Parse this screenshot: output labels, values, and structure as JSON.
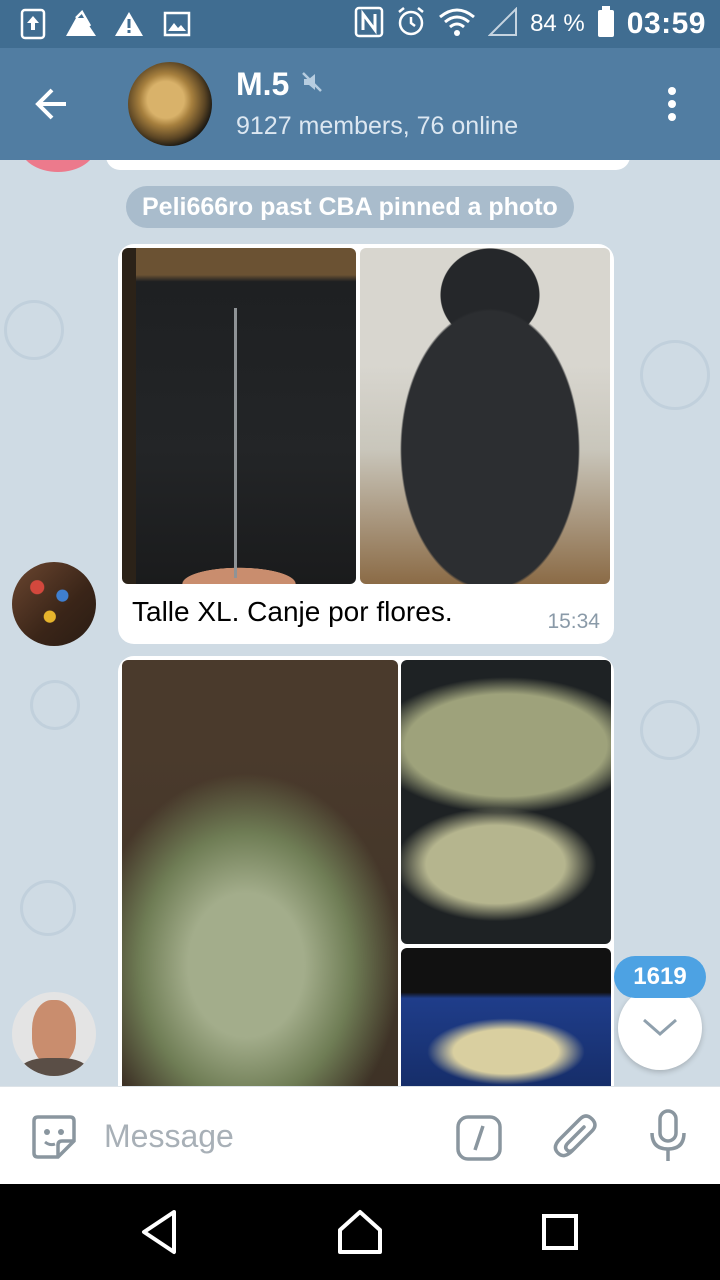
{
  "status_bar": {
    "battery_percent": "84 %",
    "time": "03:59",
    "icons": [
      "upload-icon",
      "drive-icon",
      "warning-icon",
      "image-icon",
      "nfc-icon",
      "alarm-icon",
      "wifi-icon",
      "signal-icon",
      "battery-icon"
    ]
  },
  "header": {
    "title": "M.5",
    "subtitle": "9127 members, 76 online",
    "muted": true
  },
  "chat": {
    "service_message": "Peli666ro past CBA pinned a photo",
    "messages": [
      {
        "type": "photo-album",
        "photos": [
          "jacket-front-photo",
          "jacket-back-photo"
        ],
        "caption": "Talle XL. Canje por flores.",
        "time": "15:34"
      },
      {
        "type": "photo-album",
        "photos": [
          "bud-closeup-photo",
          "bud-top-photo",
          "bud-on-tray-photo"
        ]
      }
    ],
    "unread_count": "1619"
  },
  "input": {
    "placeholder": "Message"
  },
  "colors": {
    "header": "#517da2",
    "status_bar": "#406d91",
    "chat_background": "#cfdbe4",
    "badge": "#4da2e3"
  }
}
